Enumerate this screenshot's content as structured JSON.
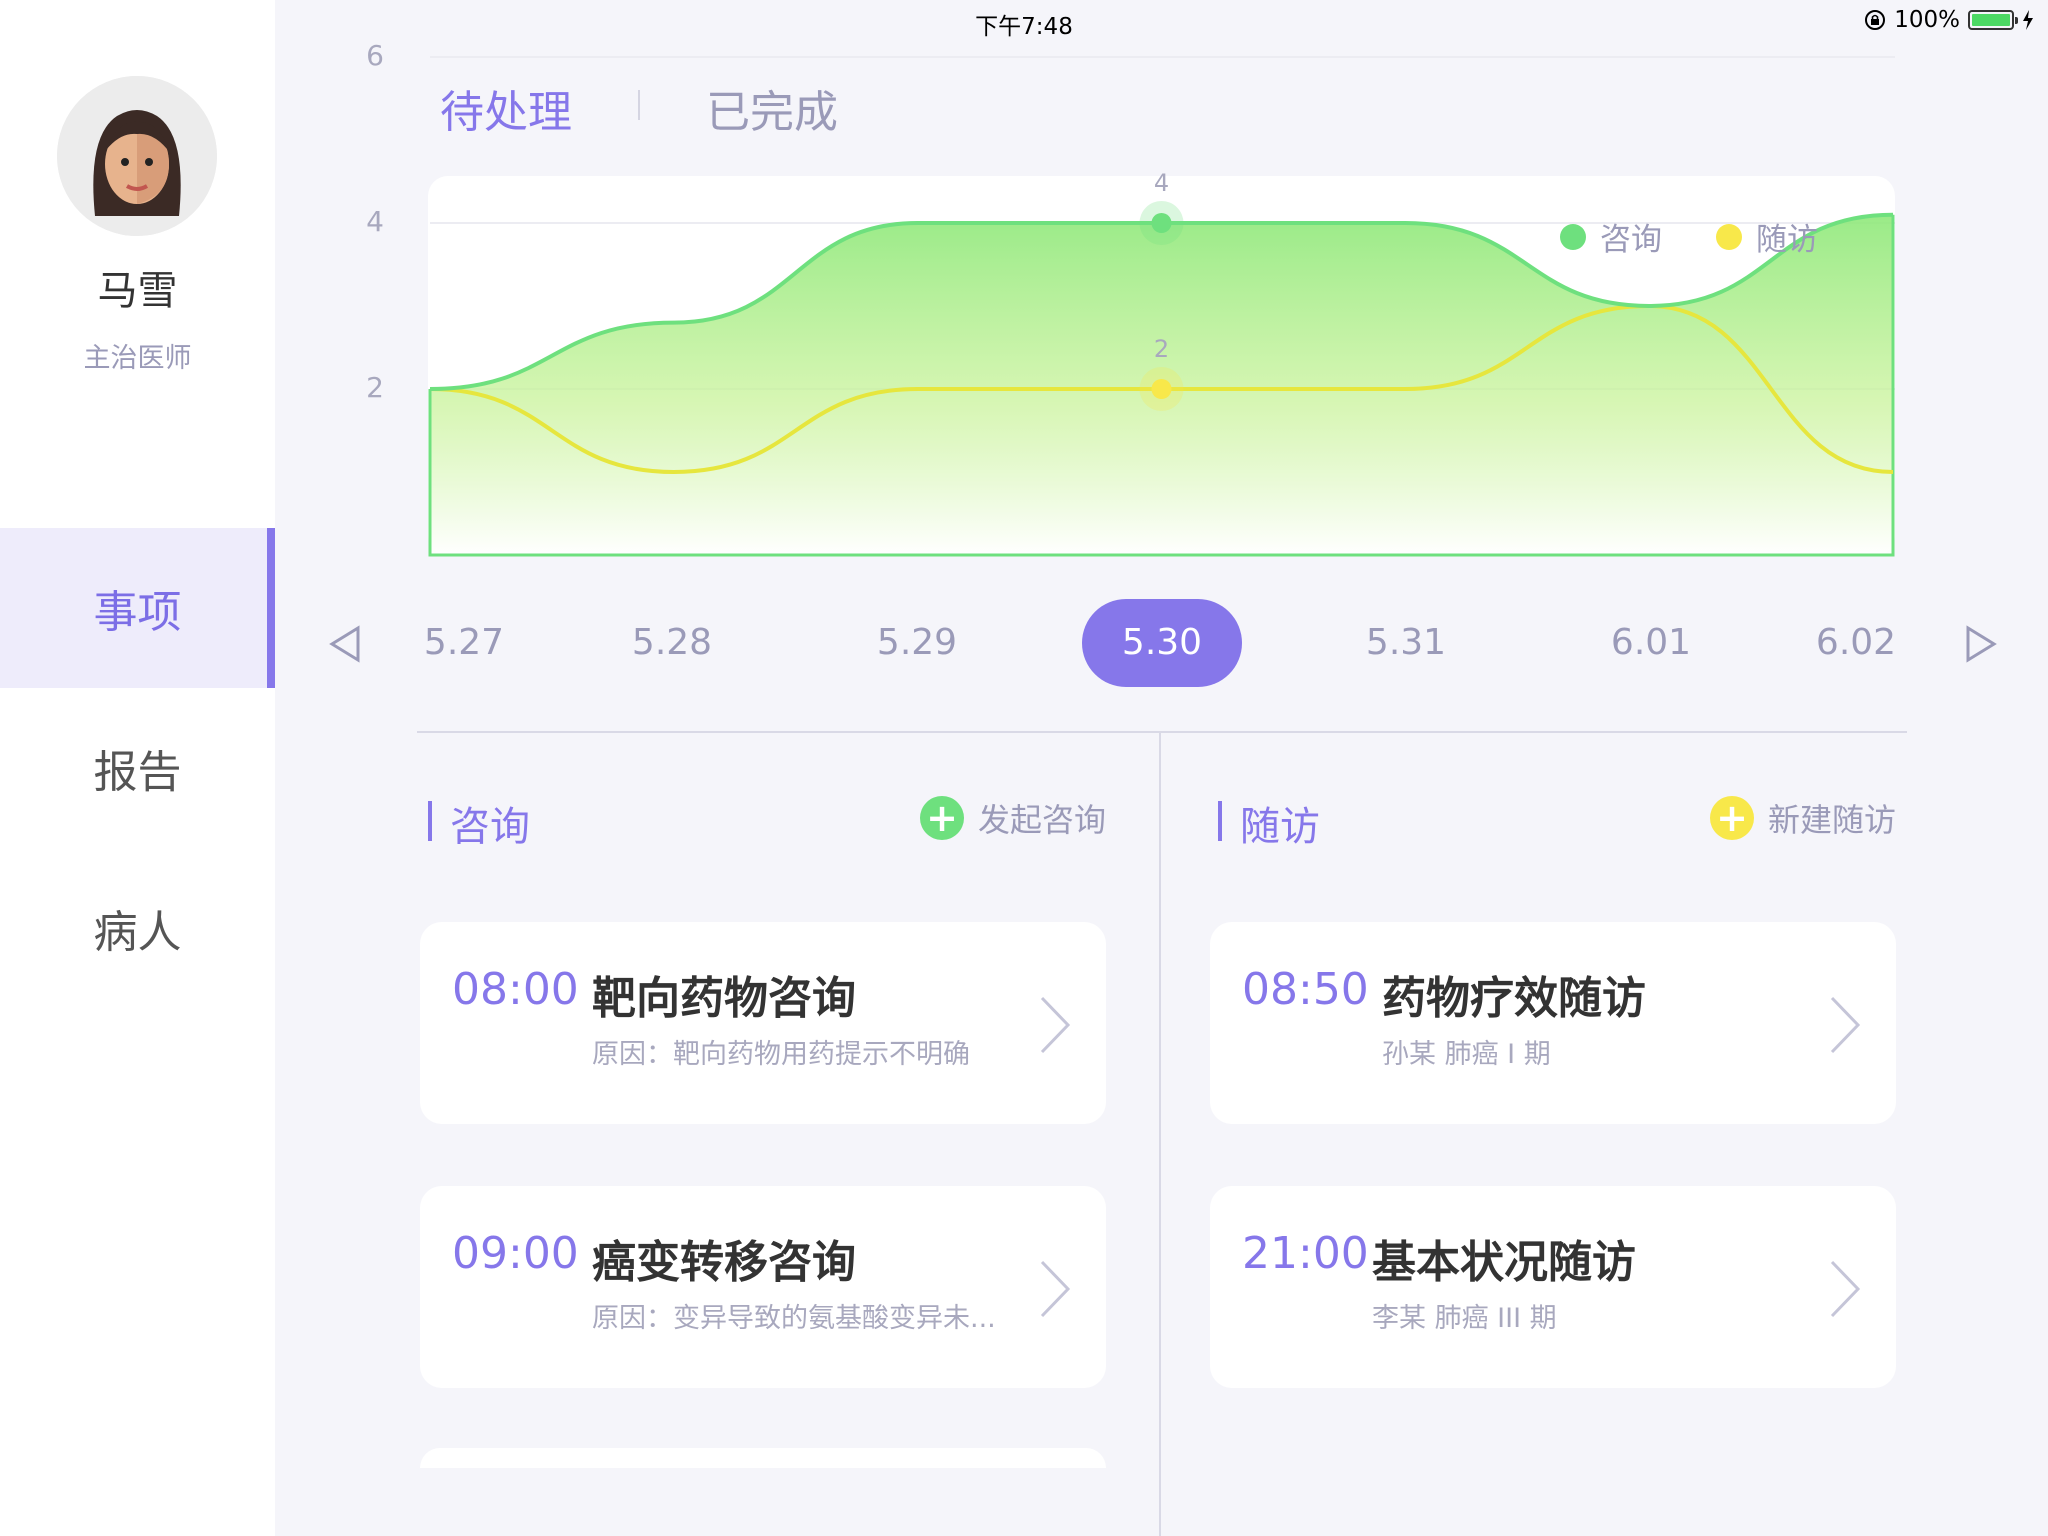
{
  "status_bar": {
    "device": "iPad",
    "time": "下午7:48",
    "battery": "100%"
  },
  "profile": {
    "name": "马雪",
    "title": "主治医师"
  },
  "nav": {
    "items": [
      {
        "label": "事项"
      },
      {
        "label": "报告"
      },
      {
        "label": "病人"
      }
    ]
  },
  "tabs": {
    "pending": "待处理",
    "done": "已完成"
  },
  "legend": {
    "consult": "咨询",
    "followup": "随访"
  },
  "colors": {
    "accent": "#8677ea",
    "consult": "#6ee07e",
    "followup": "#f8e84a"
  },
  "chart_data": {
    "type": "area",
    "yticks": [
      "2",
      "4",
      "6"
    ],
    "ylim": [
      0,
      7
    ],
    "grid": true,
    "legend_position": "top-right",
    "series": [
      {
        "name": "咨询",
        "values": [
          2,
          2.8,
          4,
          4,
          4,
          3,
          4.1
        ]
      },
      {
        "name": "随访",
        "values": [
          2,
          1,
          2,
          2,
          2,
          3,
          1
        ]
      }
    ],
    "selected_index": 3,
    "selected_labels": [
      "4",
      "2"
    ]
  },
  "dates": {
    "items": [
      "5.27",
      "5.28",
      "5.29",
      "5.30",
      "5.31",
      "6.01",
      "6.02"
    ]
  },
  "consult": {
    "title": "咨询",
    "action": "发起咨询",
    "cards": [
      {
        "time": "08:00",
        "title": "靶向药物咨询",
        "sub": "原因：靶向药物用药提示不明确"
      },
      {
        "time": "09:00",
        "title": "癌变转移咨询",
        "sub": "原因：变异导致的氨基酸变异未..."
      }
    ]
  },
  "followup": {
    "title": "随访",
    "action": "新建随访",
    "cards": [
      {
        "time": "08:50",
        "title": "药物疗效随访",
        "sub": "孙某   肺癌 I 期"
      },
      {
        "time": "21:00",
        "title": "基本状况随访",
        "sub": "李某   肺癌 III 期"
      }
    ]
  }
}
